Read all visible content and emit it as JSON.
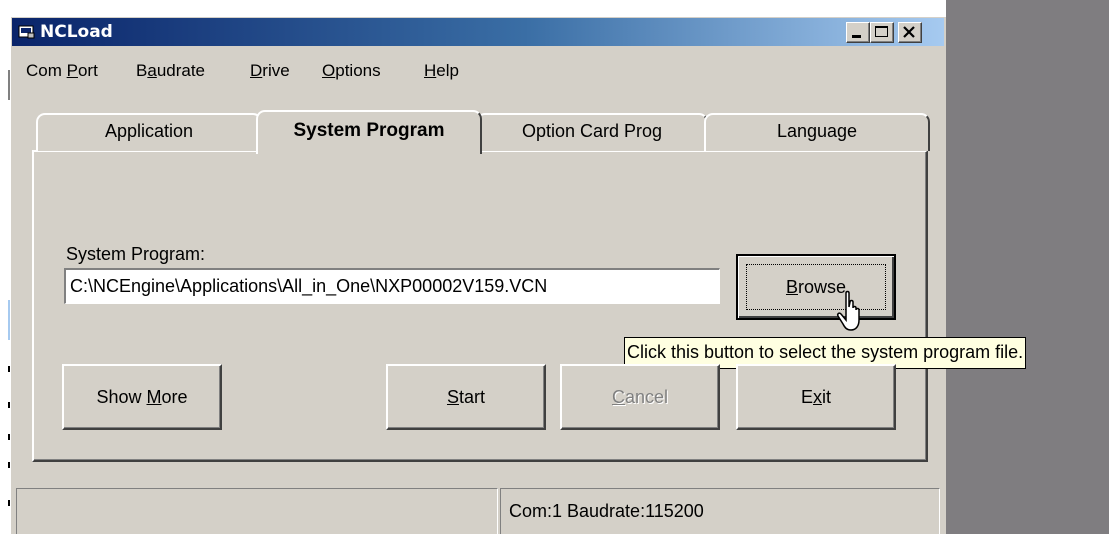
{
  "window": {
    "title": "NCLoad"
  },
  "menu": [
    {
      "pre": "Com ",
      "key": "P",
      "post": "ort"
    },
    {
      "pre": "B",
      "key": "a",
      "post": "udrate"
    },
    {
      "pre": "",
      "key": "D",
      "post": "rive"
    },
    {
      "pre": "",
      "key": "O",
      "post": "ptions"
    },
    {
      "pre": "",
      "key": "H",
      "post": "elp"
    }
  ],
  "tabs": [
    {
      "label": "Application",
      "active": false
    },
    {
      "label": "System Program",
      "active": true
    },
    {
      "label": "Option Card Prog",
      "active": false
    },
    {
      "label": "Language",
      "active": false
    }
  ],
  "system_program": {
    "label": "System Program:",
    "path_value": "C:\\NCEngine\\Applications\\All_in_One\\NXP00002V159.VCN"
  },
  "buttons": {
    "browse": {
      "pre": "",
      "key": "B",
      "post": "rowse"
    },
    "show_more": {
      "pre": "Show ",
      "key": "M",
      "post": "ore"
    },
    "start": {
      "pre": "",
      "key": "S",
      "post": "tart"
    },
    "cancel": {
      "pre": "",
      "key": "C",
      "post": "ancel",
      "enabled": false
    },
    "exit": {
      "pre": "E",
      "key": "x",
      "post": "it"
    }
  },
  "tooltip": "Click this button to select the system program file.",
  "status": {
    "left": "",
    "right": "Com:1  Baudrate:115200"
  },
  "colors": {
    "face": "#d4d0c8",
    "title_start": "#0a246a",
    "title_end": "#a6caf0",
    "tooltip_bg": "#ffffe1",
    "desktop": "#7f7d80"
  }
}
